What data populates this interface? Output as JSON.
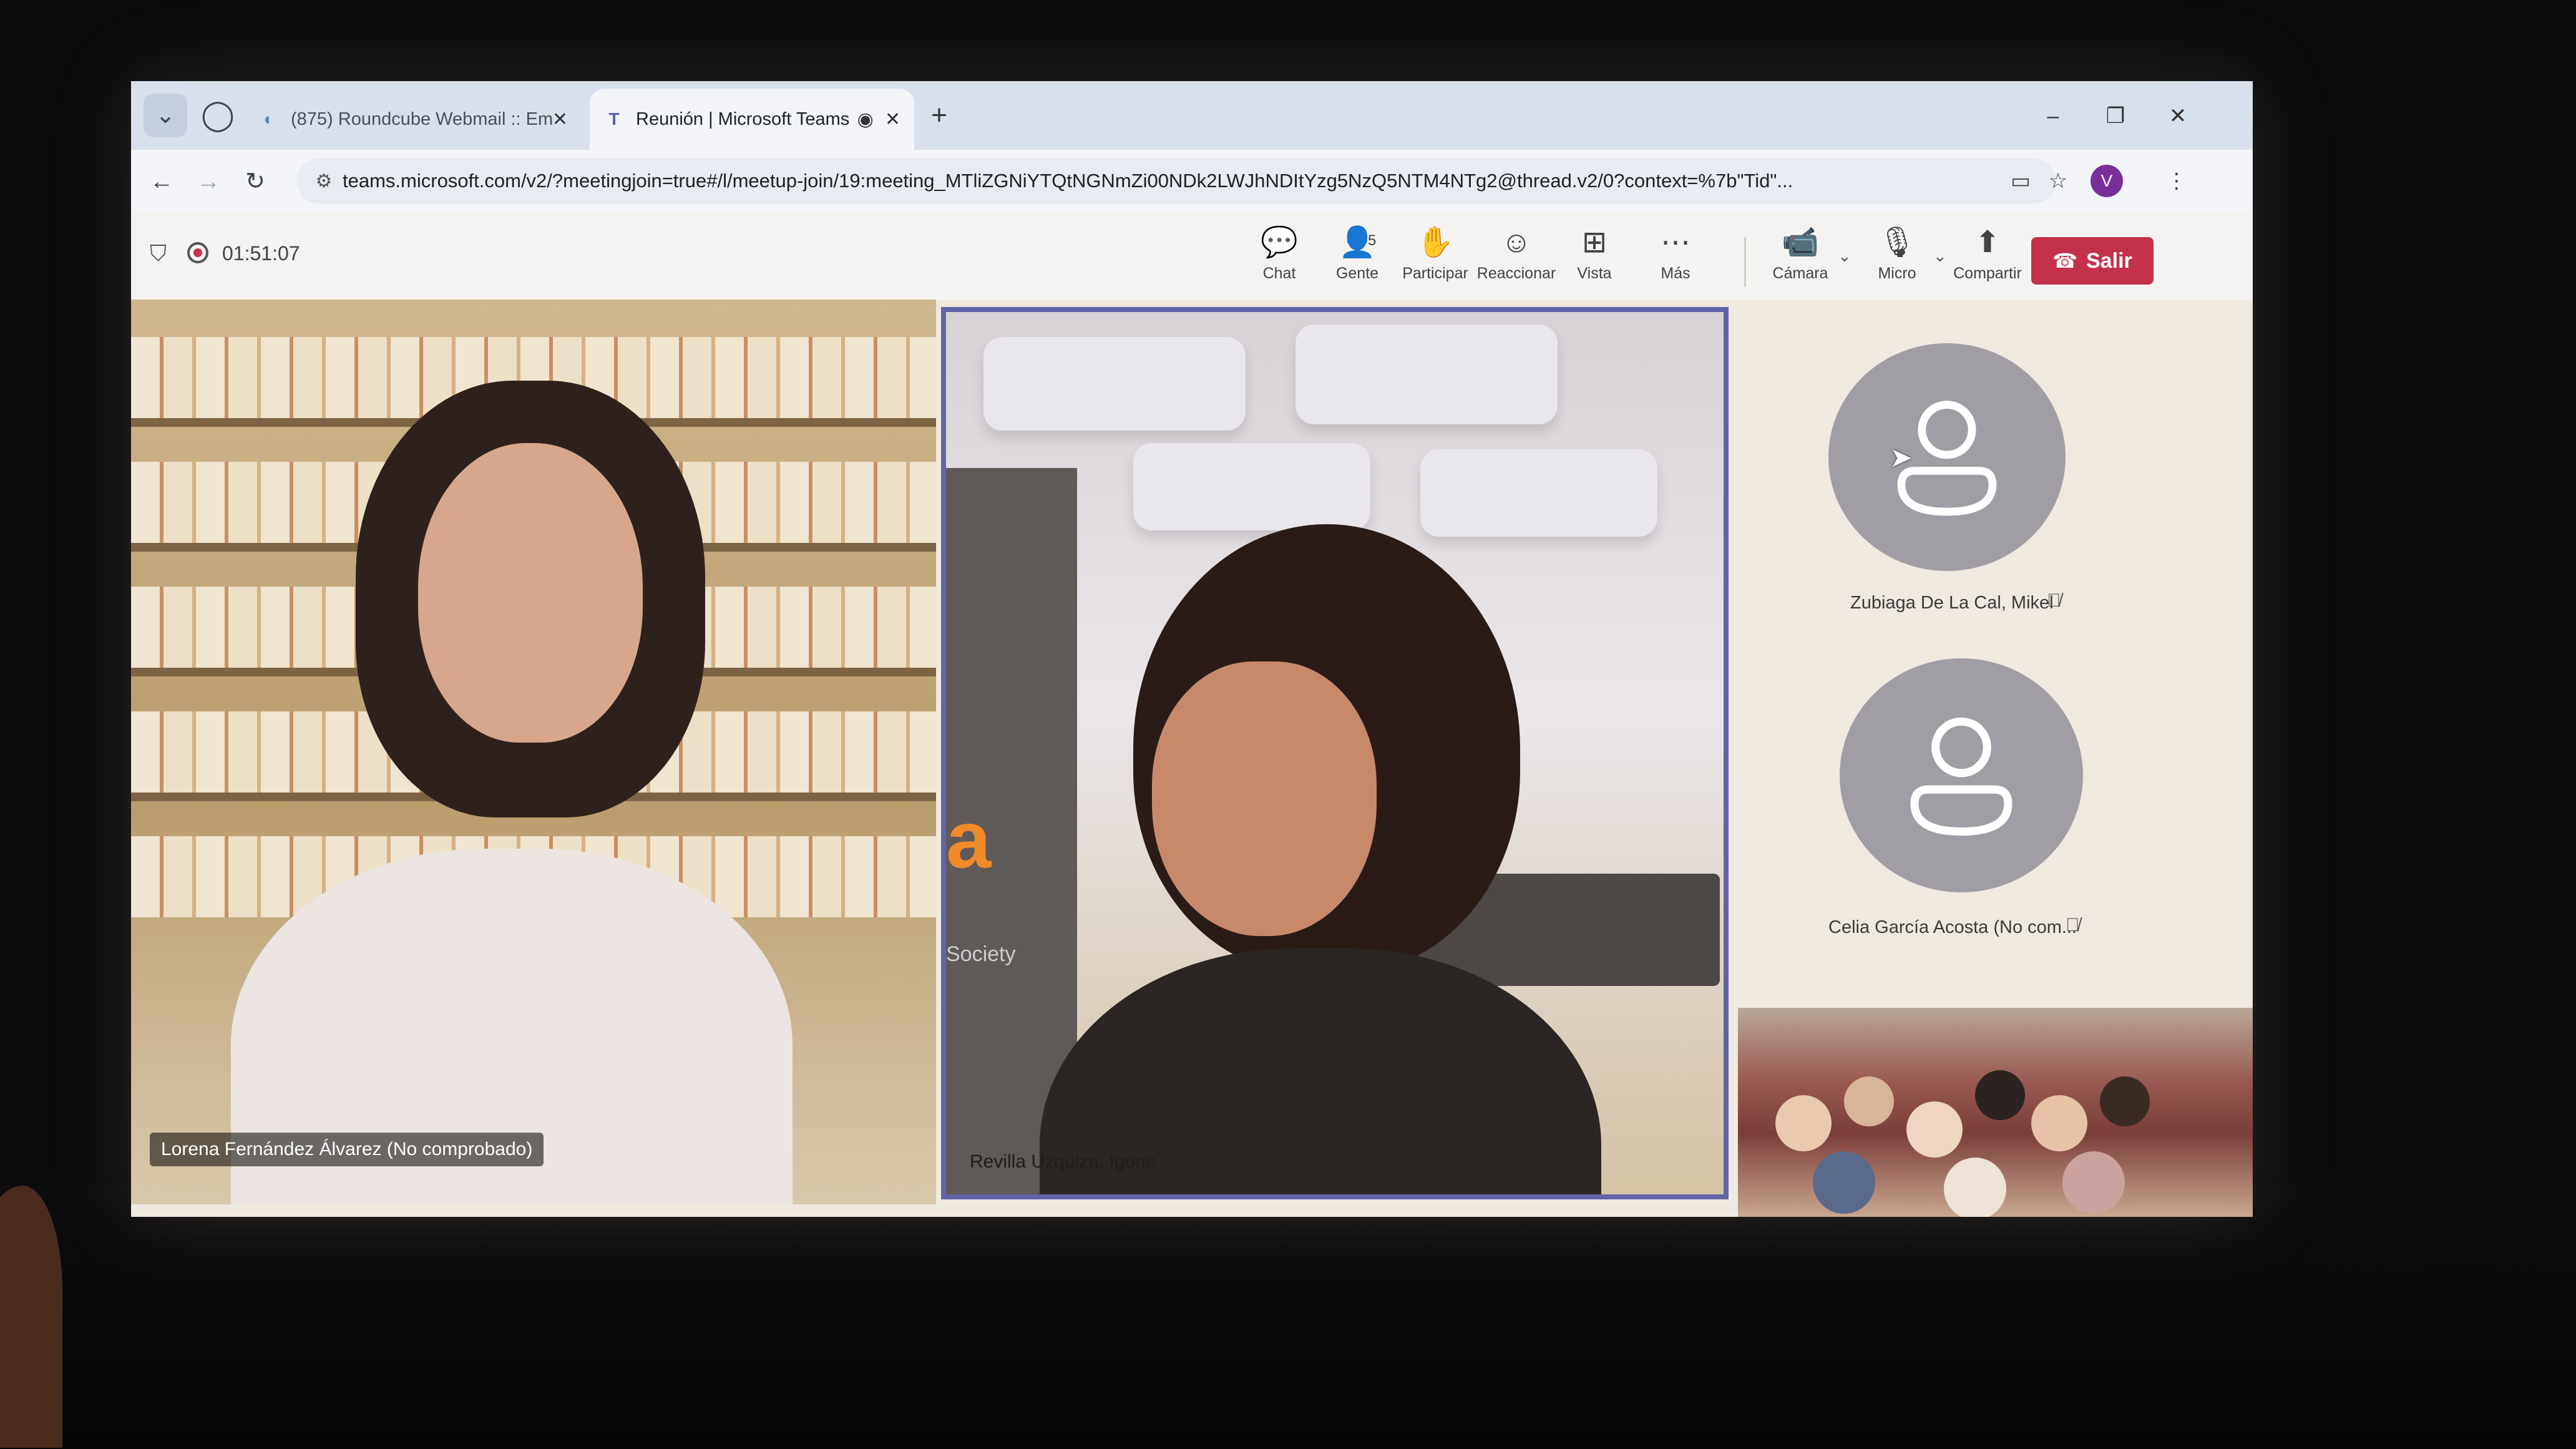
{
  "browser": {
    "tabs": [
      {
        "title": "(875) Roundcube Webmail :: Em",
        "active": false
      },
      {
        "title": "Reunión | Microsoft Teams",
        "active": true
      }
    ],
    "url": "teams.microsoft.com/v2/?meetingjoin=true#/l/meetup-join/19:meeting_MTliZGNiYTQtNGNmZi00NDk2LWJhNDItYzg5NzQ5NTM4NTg2@thread.v2/0?context=%7b\"Tid\"...",
    "profile_initial": "V"
  },
  "meeting": {
    "timer": "01:51:07",
    "people_count": "5",
    "toolbar": {
      "chat": "Chat",
      "people": "Gente",
      "raise": "Participar",
      "react": "Reaccionar",
      "view": "Vista",
      "more": "Más",
      "camera": "Cámara",
      "mic": "Micro",
      "share": "Compartir",
      "leave": "Salir"
    },
    "participants": {
      "tile_left": "Lorena Fernández Álvarez (No comprobado)",
      "tile_center": "Revilla Uzquiza, Igone",
      "side_1": "Zubiaga De La Cal, Mikel",
      "side_2": "Celia García Acosta (No com..."
    },
    "background_text": {
      "logo_fragment": "a",
      "logo_sub": "Society"
    },
    "more_dots": "···"
  },
  "colors": {
    "accent": "#6264a7",
    "leave": "#c4314b",
    "avatar_bg": "#a19da5"
  }
}
